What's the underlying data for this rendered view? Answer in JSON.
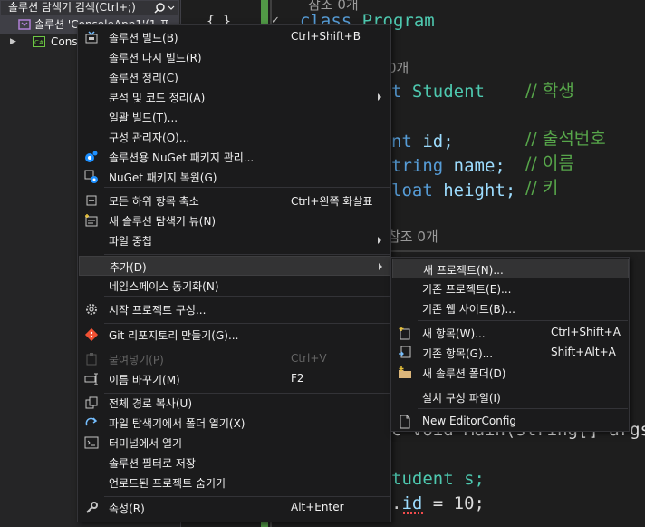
{
  "solution_explorer": {
    "search_placeholder": "솔루션 탐색기 검색(Ctrl+;)",
    "rows": [
      {
        "label": "솔루션 'ConsoleApp1'(1 프"
      },
      {
        "label": "Conso"
      }
    ]
  },
  "editor": {
    "ref_top": "참조 0개",
    "line_class_kw": "class",
    "line_class_name": "Program",
    "ref_2": "0개",
    "line_student_a": "t",
    "line_student_b": "Student",
    "comment_student": "// 학생",
    "line_id_a": "nt",
    "line_id_b": "id;",
    "comment_id": "// 출석번호",
    "line_name_a": "tring",
    "line_name_b": "name;",
    "comment_name": "// 이름",
    "line_height_a": "loat",
    "line_height_b": "height;",
    "comment_height": "// 키",
    "ref_3": "참조 0개",
    "line_args_a": "c void Main(string[] args",
    "line_s_a": "tudent s;",
    "line_sid_a": ".",
    "line_sid_b": "id",
    "line_sid_c": " = 10;",
    "brace_open": "{ }",
    "fold_marker": "✓"
  },
  "context_menu": {
    "items": [
      {
        "label": "솔루션 빌드(B)",
        "shortcut": "Ctrl+Shift+B",
        "icon": "build-icon"
      },
      {
        "label": "솔루션 다시 빌드(R)",
        "shortcut": ""
      },
      {
        "label": "솔루션 정리(C)",
        "shortcut": ""
      },
      {
        "label": "분석 및 코드 정리(A)",
        "shortcut": "",
        "submenu": true
      },
      {
        "label": "일괄 빌드(T)...",
        "shortcut": ""
      },
      {
        "label": "구성 관리자(O)...",
        "shortcut": ""
      },
      {
        "label": "솔루션용 NuGet 패키지 관리...",
        "shortcut": "",
        "icon": "nuget-icon"
      },
      {
        "label": "NuGet 패키지 복원(G)",
        "shortcut": "",
        "icon": "nuget-restore-icon"
      },
      {
        "label": "모든 하위 항목 축소",
        "shortcut": "Ctrl+왼쪽 화살표",
        "icon": "collapse-all-icon"
      },
      {
        "label": "새 솔루션 탐색기 뷰(N)",
        "shortcut": "",
        "icon": "new-view-icon"
      },
      {
        "label": "파일 중첩",
        "shortcut": "",
        "submenu": true
      },
      {
        "label": "추가(D)",
        "shortcut": "",
        "submenu": true,
        "highlighted": true
      },
      {
        "label": "네임스페이스 동기화(N)",
        "shortcut": ""
      },
      {
        "label": "시작 프로젝트 구성...",
        "shortcut": "",
        "icon": "gear-icon"
      },
      {
        "label": "Git 리포지토리 만들기(G)...",
        "shortcut": "",
        "icon": "git-icon"
      },
      {
        "label": "붙여넣기(P)",
        "shortcut": "Ctrl+V",
        "disabled": true,
        "icon": "paste-icon"
      },
      {
        "label": "이름 바꾸기(M)",
        "shortcut": "F2",
        "icon": "rename-icon"
      },
      {
        "label": "전체 경로 복사(U)",
        "shortcut": "",
        "icon": "copy-icon"
      },
      {
        "label": "파일 탐색기에서 폴더 열기(X)",
        "shortcut": "",
        "icon": "open-folder-icon"
      },
      {
        "label": "터미널에서 열기",
        "shortcut": "",
        "icon": "terminal-icon"
      },
      {
        "label": "솔루션 필터로 저장",
        "shortcut": ""
      },
      {
        "label": "언로드된 프로젝트 숨기기",
        "shortcut": ""
      },
      {
        "label": "속성(R)",
        "shortcut": "Alt+Enter",
        "icon": "wrench-icon"
      }
    ]
  },
  "submenu": {
    "items": [
      {
        "label": "새 프로젝트(N)...",
        "shortcut": "",
        "highlighted": true
      },
      {
        "label": "기존 프로젝트(E)...",
        "shortcut": ""
      },
      {
        "label": "기존 웹 사이트(B)...",
        "shortcut": ""
      },
      {
        "label": "새 항목(W)...",
        "shortcut": "Ctrl+Shift+A",
        "icon": "new-item-icon"
      },
      {
        "label": "기존 항목(G)...",
        "shortcut": "Shift+Alt+A",
        "icon": "existing-item-icon"
      },
      {
        "label": "새 솔루션 폴더(D)",
        "shortcut": "",
        "icon": "new-folder-icon"
      },
      {
        "label": "설치 구성 파일(I)",
        "shortcut": ""
      },
      {
        "label": "New EditorConfig",
        "shortcut": "",
        "icon": "file-icon"
      }
    ]
  }
}
